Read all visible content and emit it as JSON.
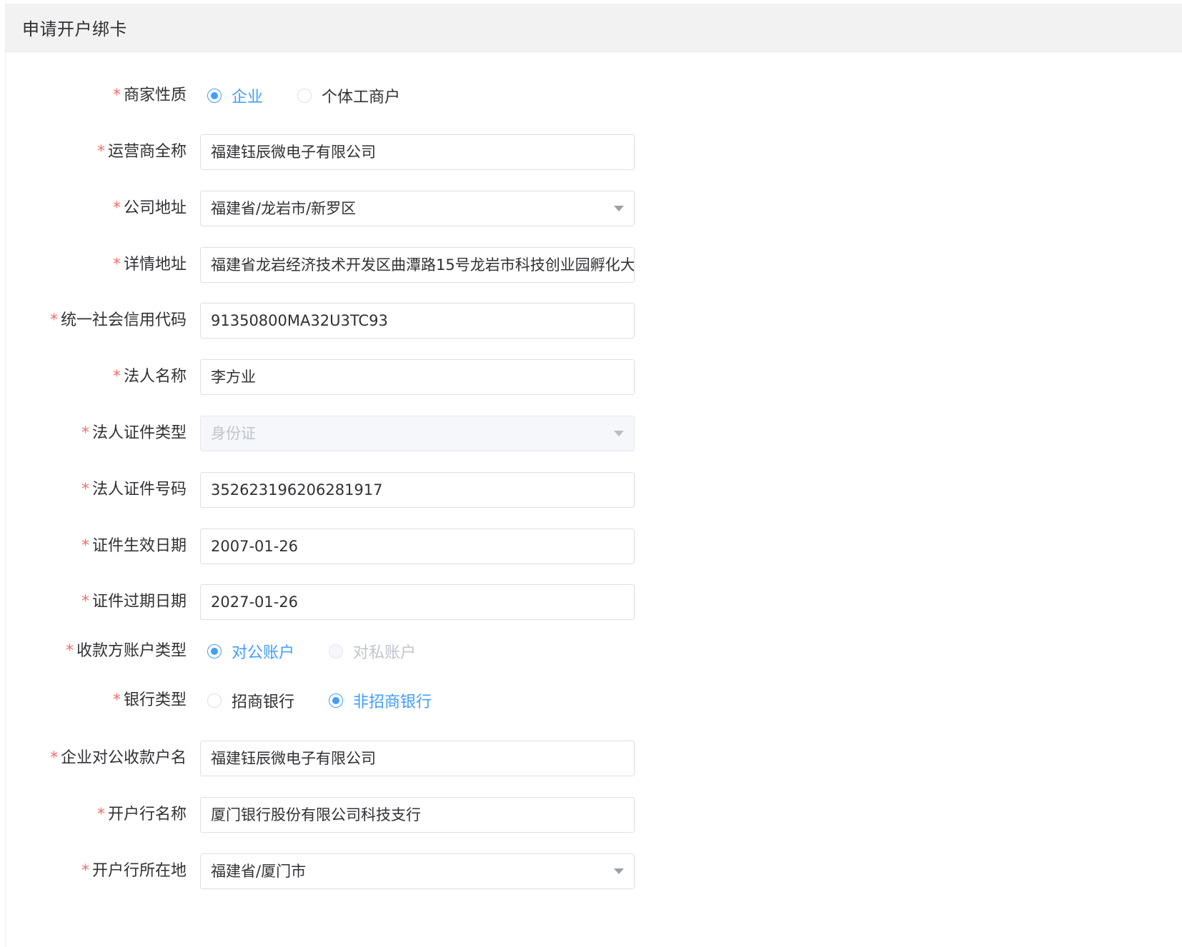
{
  "header": {
    "title": "申请开户绑卡"
  },
  "required_mark": "*",
  "form": {
    "merchant_type": {
      "label": "商家性质",
      "options": [
        {
          "label": "企业",
          "checked": true,
          "disabled": false
        },
        {
          "label": "个体工商户",
          "checked": false,
          "disabled": false
        }
      ]
    },
    "operator_name": {
      "label": "运营商全称",
      "value": "福建钰辰微电子有限公司"
    },
    "company_address": {
      "label": "公司地址",
      "value": "福建省/龙岩市/新罗区"
    },
    "detail_address": {
      "label": "详情地址",
      "value": "福建省龙岩经济技术开发区曲潭路15号龙岩市科技创业园孵化大"
    },
    "credit_code": {
      "label": "统一社会信用代码",
      "value": "91350800MA32U3TC93"
    },
    "legal_person_name": {
      "label": "法人名称",
      "value": "李方业"
    },
    "legal_id_type": {
      "label": "法人证件类型",
      "value": "身份证"
    },
    "legal_id_number": {
      "label": "法人证件号码",
      "value": "352623196206281917"
    },
    "id_valid_from": {
      "label": "证件生效日期",
      "value": "2007-01-26"
    },
    "id_valid_to": {
      "label": "证件过期日期",
      "value": "2027-01-26"
    },
    "payee_account_type": {
      "label": "收款方账户类型",
      "options": [
        {
          "label": "对公账户",
          "checked": true,
          "disabled": false
        },
        {
          "label": "对私账户",
          "checked": false,
          "disabled": true
        }
      ]
    },
    "bank_type": {
      "label": "银行类型",
      "options": [
        {
          "label": "招商银行",
          "checked": false,
          "disabled": false
        },
        {
          "label": "非招商银行",
          "checked": true,
          "disabled": false
        }
      ]
    },
    "corporate_account_name": {
      "label": "企业对公收款户名",
      "value": "福建钰辰微电子有限公司"
    },
    "bank_name": {
      "label": "开户行名称",
      "value": "厦门银行股份有限公司科技支行"
    },
    "bank_location": {
      "label": "开户行所在地",
      "value": "福建省/厦门市"
    }
  },
  "colors": {
    "accent": "#409eff",
    "required": "#f56c6c",
    "header_bg": "#f2f2f2",
    "disabled_bg": "#f5f7fa"
  }
}
